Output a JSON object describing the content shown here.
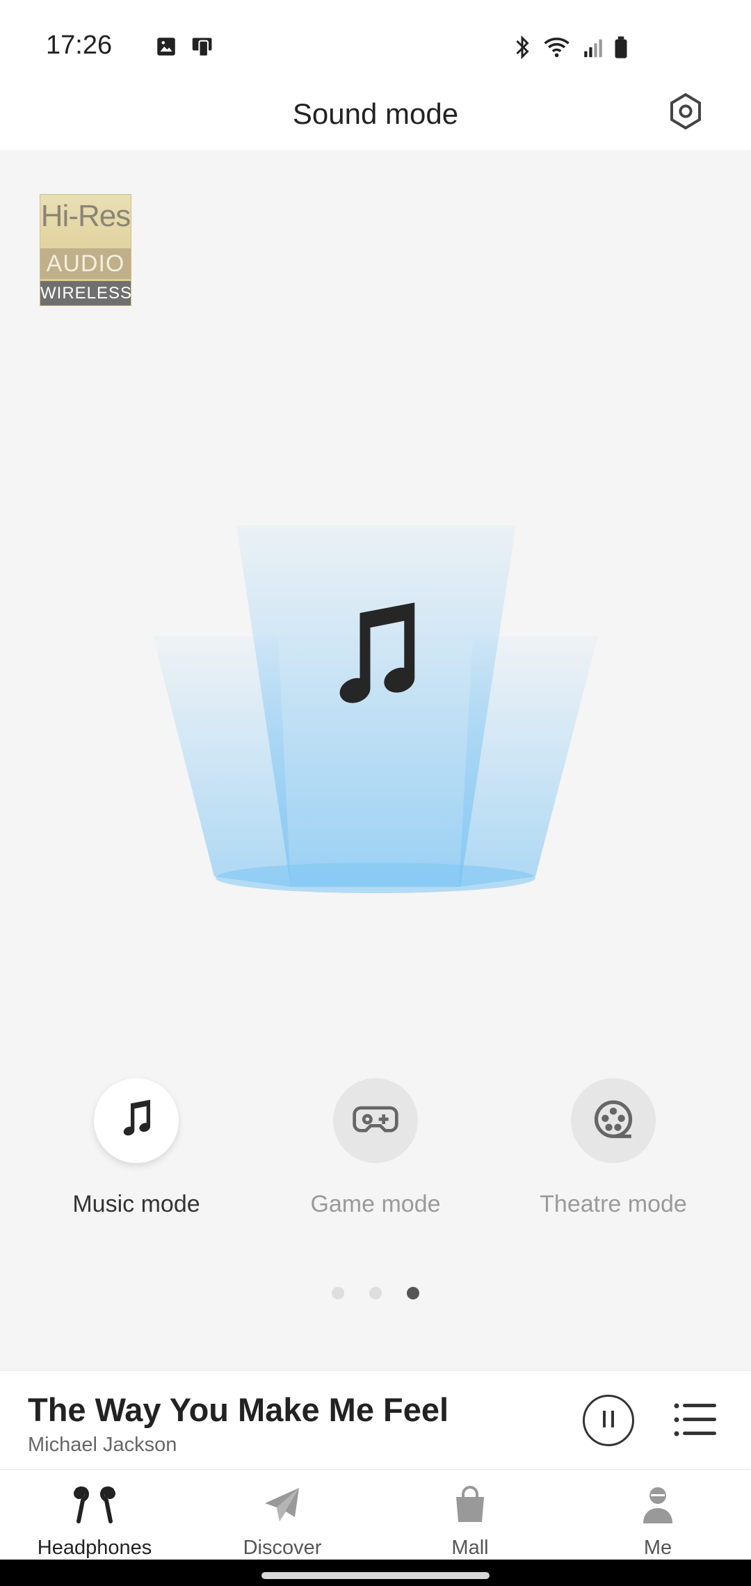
{
  "status_bar": {
    "time": "17:26",
    "left_icons": [
      "image-icon",
      "screen-cast-icon"
    ],
    "right_icons": [
      "bluetooth-icon",
      "wifi-icon",
      "signal-icon",
      "battery-icon"
    ]
  },
  "header": {
    "title": "Sound mode",
    "settings_icon": "settings-icon"
  },
  "badge": {
    "line1": "Hi-Res",
    "line2": "AUDIO",
    "line3": "WIRELESS"
  },
  "hero": {
    "icon": "music-note-icon",
    "accent_color": "#7cc4f4"
  },
  "modes": [
    {
      "label": "Music mode",
      "icon": "music-note-icon",
      "active": true
    },
    {
      "label": "Game mode",
      "icon": "gamepad-icon",
      "active": false
    },
    {
      "label": "Theatre mode",
      "icon": "film-reel-icon",
      "active": false
    }
  ],
  "pager": {
    "count": 3,
    "active_index": 2
  },
  "now_playing": {
    "title": "The Way You Make Me Feel",
    "artist": "Michael Jackson",
    "pause_icon": "pause-icon",
    "playlist_icon": "playlist-icon"
  },
  "tabs": [
    {
      "label": "Headphones",
      "icon": "earbuds-icon",
      "active": true
    },
    {
      "label": "Discover",
      "icon": "paper-plane-icon",
      "active": false
    },
    {
      "label": "Mall",
      "icon": "shopping-bag-icon",
      "active": false
    },
    {
      "label": "Me",
      "icon": "person-icon",
      "active": false
    }
  ]
}
